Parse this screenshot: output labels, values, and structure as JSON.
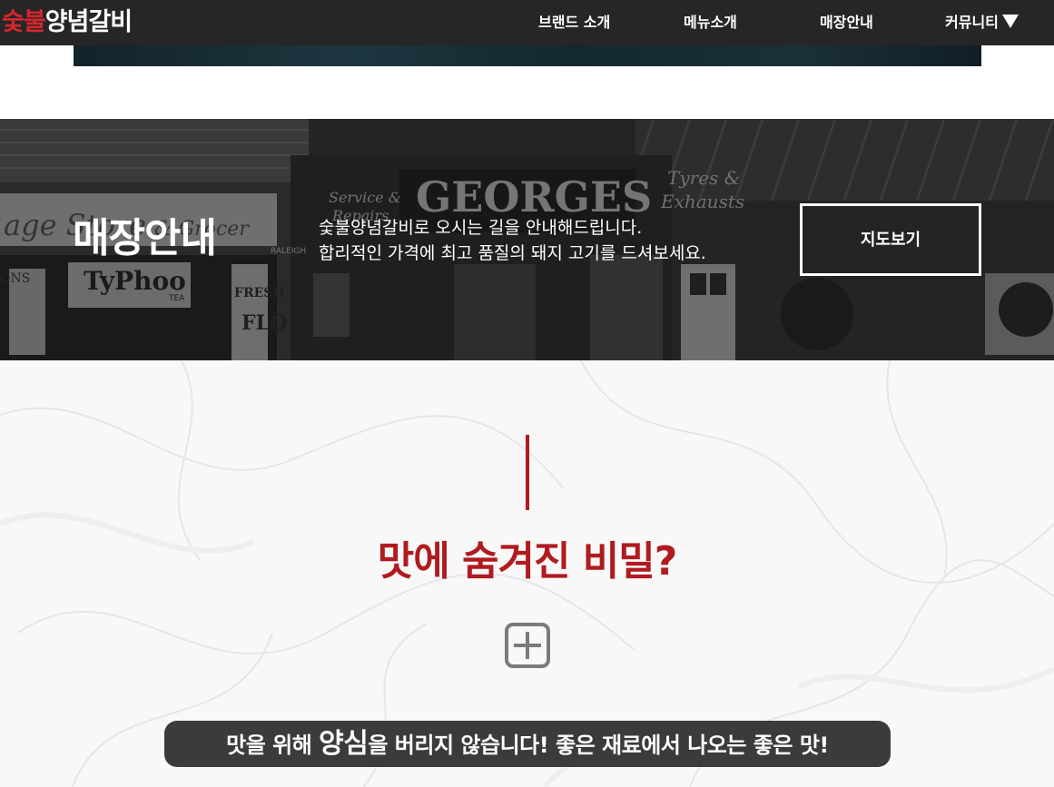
{
  "header": {
    "logo": {
      "red_part": "숯불",
      "white_part": "양념갈비"
    },
    "nav": [
      {
        "label": "브랜드 소개"
      },
      {
        "label": "메뉴소개"
      },
      {
        "label": "매장안내"
      },
      {
        "label": "커뮤니티"
      }
    ]
  },
  "store": {
    "title": "매장안내",
    "desc_line1": "숯불양념갈비로 오시는 길을 안내해드립니다.",
    "desc_line2": "합리적인 가격에 최고 품질의 돼지 고기를 드셔보세요.",
    "map_button": "지도보기",
    "background_signs": {
      "shop_name": "GEORGES",
      "tyres": "Tyres &",
      "exhausts": "Exhausts",
      "service": "Service &",
      "repairs": "Repairs",
      "village_store": "age Store",
      "grocer": "& Grocer",
      "typhoo": "TyPhoo",
      "tea": "TEA",
      "fresh": "FRESH",
      "raleigh": "RALEIGH",
      "flo": "FLO",
      "ons": "ONS"
    }
  },
  "secret": {
    "title": "맛에 숨겨진 비밀?",
    "slogan_pre": "맛을 위해 ",
    "slogan_highlight": "양심",
    "slogan_post": "을 버리지 않습니다! 좋은 재료에서 나오는 좋은 맛!"
  },
  "colors": {
    "accent_red": "#b01b1f",
    "logo_red": "#d3262d",
    "nav_bg": "#262626",
    "slogan_bg": "#3b3b3b"
  }
}
